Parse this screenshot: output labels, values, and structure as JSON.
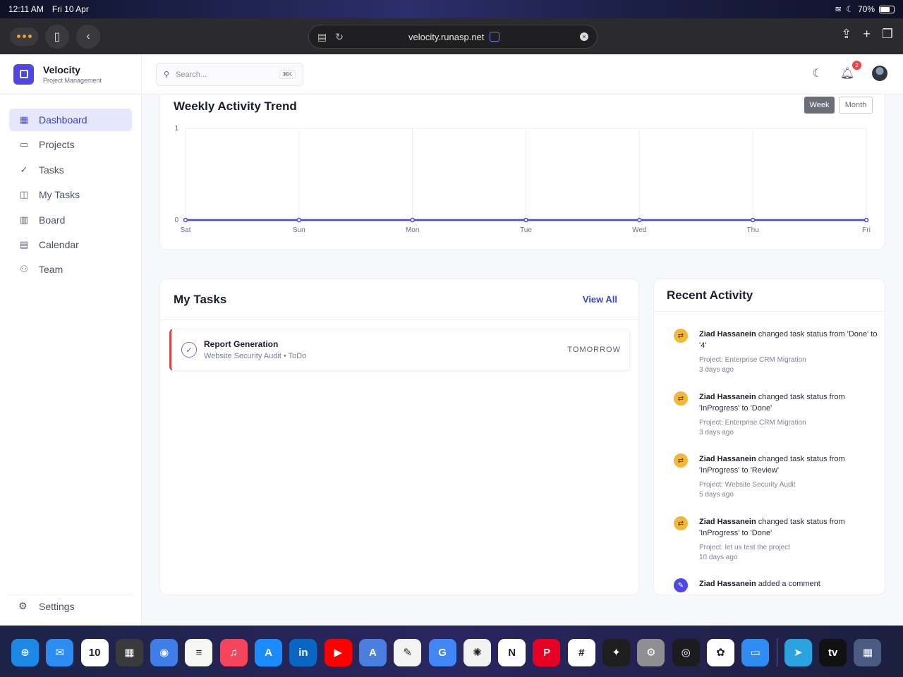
{
  "status_bar": {
    "time": "12:11 AM",
    "date": "Fri 10 Apr",
    "battery": "70%",
    "battery_level": 0.7
  },
  "browser": {
    "url": "velocity.runasp.net"
  },
  "app": {
    "name": "Velocity",
    "subtitle": "Project Management"
  },
  "sidebar": {
    "items": [
      {
        "label": "Dashboard",
        "icon": "dashboard-icon",
        "active": true
      },
      {
        "label": "Projects",
        "icon": "folder-icon"
      },
      {
        "label": "Tasks",
        "icon": "check-circle-icon"
      },
      {
        "label": "My Tasks",
        "icon": "user-task-icon"
      },
      {
        "label": "Board",
        "icon": "board-icon"
      },
      {
        "label": "Calendar",
        "icon": "calendar-icon"
      },
      {
        "label": "Team",
        "icon": "team-icon"
      }
    ],
    "settings_label": "Settings"
  },
  "header": {
    "search_placeholder": "Search...",
    "search_shortcut": "⌘K",
    "notification_count": "2"
  },
  "chart": {
    "toggle_week": "Week",
    "toggle_month": "Month",
    "line_color": "#4f46e5"
  },
  "chart_data": {
    "type": "line",
    "title": "Weekly Activity Trend",
    "categories": [
      "Sat",
      "Sun",
      "Mon",
      "Tue",
      "Wed",
      "Thu",
      "Fri"
    ],
    "series": [
      {
        "values": [
          0,
          0,
          0,
          0,
          0,
          0,
          0
        ]
      }
    ],
    "ylim": [
      0,
      1
    ],
    "yticks": [
      "0",
      "1"
    ],
    "grid": true
  },
  "my_tasks": {
    "title": "My Tasks",
    "view_all": "View All",
    "items": [
      {
        "name": "Report Generation",
        "project_status": "Website Security Audit • ToDo",
        "due": "TOMORROW"
      }
    ]
  },
  "activity": {
    "title": "Recent Activity",
    "items": [
      {
        "user": "Ziad Hassanein",
        "text": "changed task status from 'Done' to '4'",
        "project": "Project: Enterprise CRM Migration",
        "when": "3 days ago"
      },
      {
        "user": "Ziad Hassanein",
        "text": "changed task status from 'InProgress' to 'Done'",
        "project": "Project: Enterprise CRM Migration",
        "when": "3 days ago"
      },
      {
        "user": "Ziad Hassanein",
        "text": "changed task status from 'InProgress' to 'Review'",
        "project": "Project: Website Security Audit",
        "when": "5 days ago"
      },
      {
        "user": "Ziad Hassanein",
        "text": "changed task status from 'InProgress' to 'Done'",
        "project": "Project: let us test the project",
        "when": "10 days ago"
      },
      {
        "user": "Ziad Hassanein",
        "text": "added a comment",
        "project": "",
        "when": ""
      }
    ]
  },
  "dock": {
    "apps": [
      {
        "name": "safari-icon",
        "color": "#1e88e5",
        "glyph": "⊕"
      },
      {
        "name": "mail-icon",
        "color": "#2d8cf0",
        "glyph": "✉"
      },
      {
        "name": "calendar-app-icon",
        "color": "#ffffff",
        "glyph": "10"
      },
      {
        "name": "calculator-icon",
        "color": "#3a3a3c",
        "glyph": "▦"
      },
      {
        "name": "database-icon",
        "color": "#3f7ee8",
        "glyph": "◉"
      },
      {
        "name": "notes-icon",
        "color": "#f6f6f2",
        "glyph": "≡"
      },
      {
        "name": "music-icon",
        "color": "#f5455c",
        "glyph": "♫"
      },
      {
        "name": "app-store-icon",
        "color": "#1a8cff",
        "glyph": "A"
      },
      {
        "name": "linkedin-icon",
        "color": "#0a66c2",
        "glyph": "in"
      },
      {
        "name": "youtube-icon",
        "color": "#ff0000",
        "glyph": "▶"
      },
      {
        "name": "translate-icon",
        "color": "#4a7fe0",
        "glyph": "A"
      },
      {
        "name": "freeform-icon",
        "color": "#f3f3f3",
        "glyph": "✎"
      },
      {
        "name": "google-translate-icon",
        "color": "#4285f4",
        "glyph": "G"
      },
      {
        "name": "chatgpt-icon",
        "color": "#f2f2f2",
        "glyph": "✺"
      },
      {
        "name": "notion-icon",
        "color": "#ffffff",
        "glyph": "N"
      },
      {
        "name": "pinterest-icon",
        "color": "#e60023",
        "glyph": "P"
      },
      {
        "name": "slack-icon",
        "color": "#ffffff",
        "glyph": "#"
      },
      {
        "name": "figma-icon",
        "color": "#1e1e1e",
        "glyph": "✦"
      },
      {
        "name": "settings-app-icon",
        "color": "#8e8e93",
        "glyph": "⚙"
      },
      {
        "name": "camera-icon",
        "color": "#1c1c1e",
        "glyph": "◎"
      },
      {
        "name": "photos-icon",
        "color": "#ffffff",
        "glyph": "✿"
      },
      {
        "name": "files-icon",
        "color": "#2f8cf3",
        "glyph": "▭"
      },
      {
        "name": "telegram-icon",
        "color": "#2aa3e0",
        "glyph": "➤"
      },
      {
        "name": "apple-tv-icon",
        "color": "#111111",
        "glyph": "tv"
      },
      {
        "name": "app-library-icon",
        "color": "#4a5a80",
        "glyph": "▦"
      }
    ]
  }
}
